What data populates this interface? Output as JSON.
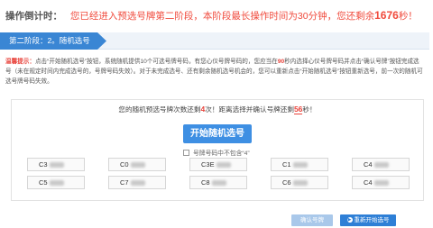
{
  "timer": {
    "label": "操作倒计时：",
    "text_prefix": "您已经进入预选号牌第二阶段，本阶段最长操作时间为30分钟，您还剩余",
    "seconds": "1676",
    "text_suffix": "秒！"
  },
  "step": {
    "label": "第二阶段：2。随机选号"
  },
  "notice": {
    "label": "温馨提示：",
    "text_part1": "点击“开始随机选号”按钮，系统随机提供10个可选号牌号码，有您心仪号牌号码的，您应当在",
    "seconds": "90",
    "text_part2": "秒内选择心仪号牌号码并点击“确认号牌”按钮完成选号（未在规定时间内完成选号的，号牌号码失效）。对于未完成选号、还有剩余随机选号机会的，您可以重新点击“开始随机选号”按钮重新选号，前一次的随机可选号牌号码失效。"
  },
  "panel": {
    "count_prefix": "您的随机预选号牌次数还剩",
    "count_value": "4",
    "count_mid": "次！距离选择并确认号牌还剩",
    "time_value": "56",
    "time_suffix": "秒！",
    "start_button": "开始随机选号",
    "filter_label": "号牌号码中不包含“4”"
  },
  "plates": [
    {
      "prefix": "C3"
    },
    {
      "prefix": "C0"
    },
    {
      "prefix": "C3E"
    },
    {
      "prefix": "C1"
    },
    {
      "prefix": "C4"
    },
    {
      "prefix": "C5"
    },
    {
      "prefix": "C7"
    },
    {
      "prefix": "C8"
    },
    {
      "prefix": "C6"
    },
    {
      "prefix": "C4"
    }
  ],
  "footer": {
    "confirm_button": "确认号牌",
    "reselect_button": "重新开始选号",
    "reselect_icon": "arrow-icon"
  },
  "colors": {
    "accent": "#3e8fe3",
    "alert": "#e8423a",
    "disabled": "#a9c8ea"
  }
}
